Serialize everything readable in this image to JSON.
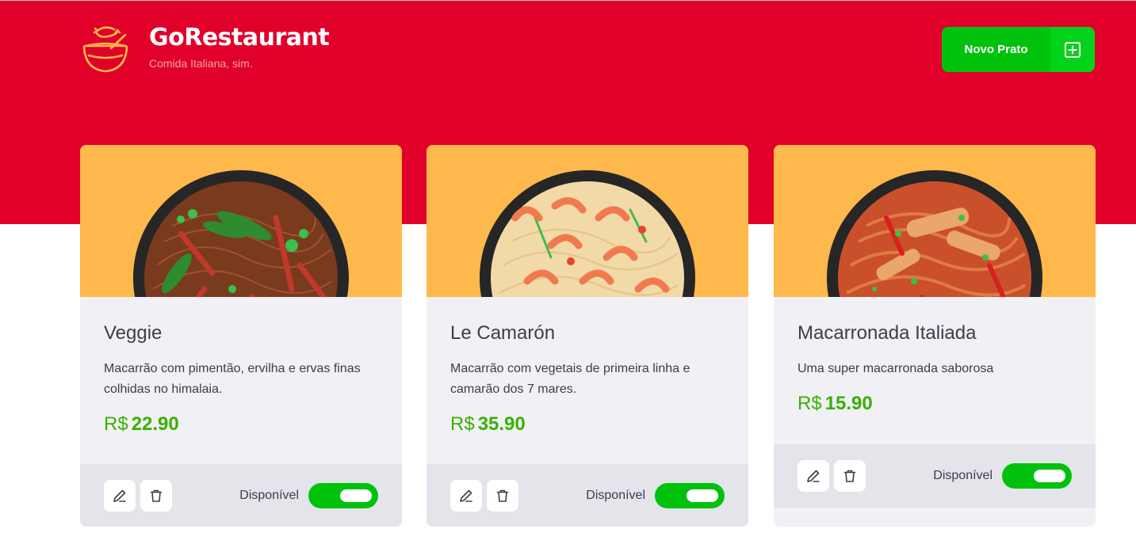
{
  "header": {
    "brand_title": "GoRestaurant",
    "brand_subtitle": "Comida Italiana, sim.",
    "new_dish_label": "Novo Prato",
    "colors": {
      "background": "#e0002a",
      "accent": "#00c20d",
      "logo": "#ffb84c"
    }
  },
  "dishes": [
    {
      "name": "Veggie",
      "description": "Macarrão com pimentão, ervilha e ervas finas colhidas no himalaia.",
      "currency": "R$",
      "price": "22.90",
      "available_label": "Disponível",
      "available": true
    },
    {
      "name": "Le Camarón",
      "description": "Macarrão com vegetais de primeira linha e camarão dos 7 mares.",
      "currency": "R$",
      "price": "35.90",
      "available_label": "Disponível",
      "available": true
    },
    {
      "name": "Macarronada Italiada",
      "description": "Uma super macarronada saborosa",
      "currency": "R$",
      "price": "15.90",
      "available_label": "Disponível",
      "available": true
    }
  ],
  "icons": {
    "logo": "bowl-icon",
    "add": "plus-square-icon",
    "edit": "pencil-icon",
    "delete": "trash-icon"
  }
}
